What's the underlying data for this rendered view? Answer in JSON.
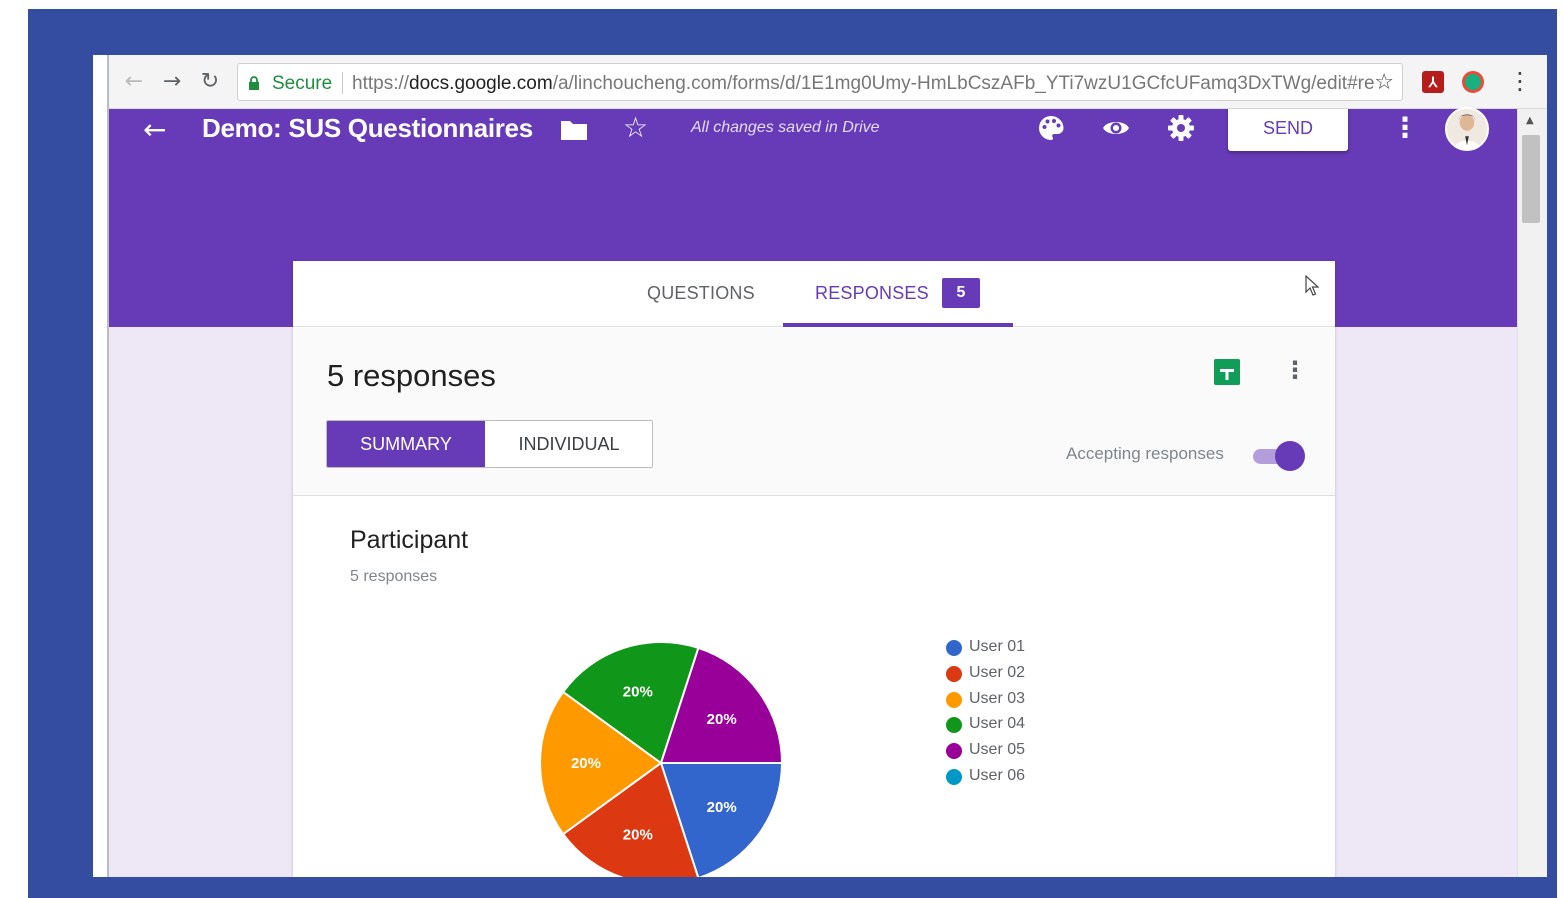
{
  "browser": {
    "secure_label": "Secure",
    "url_prefix": "https://",
    "url_domain": "docs.google.com",
    "url_path": "/a/linchoucheng.com/forms/d/1E1mg0Umy-HmLbCszAFb_YTi7wzU1GCfcUFamq3DxTWg/edit#re"
  },
  "header": {
    "title": "Demo: SUS Questionnaires",
    "saved_status": "All changes saved in Drive",
    "send_label": "SEND"
  },
  "tabs": {
    "questions_label": "QUESTIONS",
    "responses_label": "RESPONSES",
    "responses_badge": "5"
  },
  "summary": {
    "title": "5 responses",
    "summary_label": "SUMMARY",
    "individual_label": "INDIVIDUAL",
    "accepting_label": "Accepting responses",
    "accepting_on": true
  },
  "question": {
    "title": "Participant",
    "count": "5 responses"
  },
  "chart_data": {
    "type": "pie",
    "categories": [
      "User 01",
      "User 02",
      "User 03",
      "User 04",
      "User 05",
      "User 06"
    ],
    "values": [
      1,
      1,
      1,
      1,
      1,
      0
    ],
    "value_labels": [
      "20%",
      "20%",
      "20%",
      "20%",
      "20%",
      ""
    ],
    "colors": [
      "#3366cc",
      "#dc3912",
      "#ff9900",
      "#109618",
      "#990099",
      "#0099c6"
    ],
    "legend_position": "right"
  }
}
